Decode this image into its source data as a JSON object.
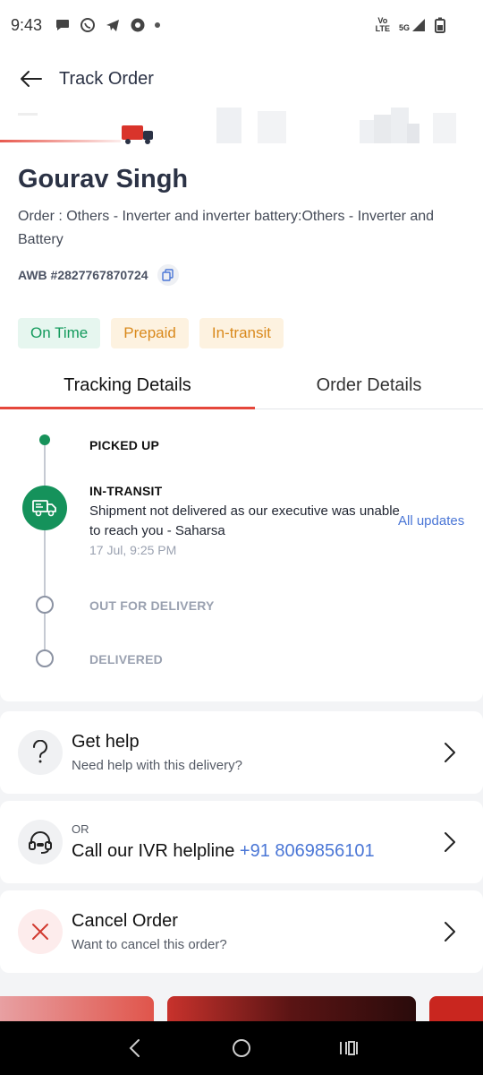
{
  "status_bar": {
    "time": "9:43",
    "network_top": "Vo",
    "network_bottom": "LTE",
    "fiveg": "5G"
  },
  "header": {
    "title": "Track Order"
  },
  "summary": {
    "customer_name": "Gourav Singh",
    "order_description": "Order : Others - Inverter and inverter battery:Others - Inverter and Battery",
    "awb": "AWB #2827767870724",
    "chips": [
      "On Time",
      "Prepaid",
      "In-transit"
    ]
  },
  "tabs": [
    "Tracking Details",
    "Order Details"
  ],
  "timeline": {
    "steps": [
      {
        "label": "PICKED UP",
        "state": "done"
      },
      {
        "label": "IN-TRANSIT",
        "state": "current"
      },
      {
        "label": "OUT FOR DELIVERY",
        "state": "pending"
      },
      {
        "label": "DELIVERED",
        "state": "pending"
      }
    ],
    "current_message": "Shipment not delivered as our executive was unable to reach you - Saharsa",
    "current_time": "17 Jul, 9:25 PM",
    "all_updates_label": "All updates"
  },
  "cards": {
    "help": {
      "title": "Get help",
      "subtitle": "Need help with this delivery?"
    },
    "ivr": {
      "prefix": "OR",
      "title": "Call our IVR helpline",
      "phone": "+91 8069856101"
    },
    "cancel": {
      "title": "Cancel Order",
      "subtitle": "Want to cancel this order?"
    }
  },
  "colors": {
    "brand_red": "#e5473b",
    "success_green": "#15925b",
    "link_blue": "#4a76d6"
  }
}
